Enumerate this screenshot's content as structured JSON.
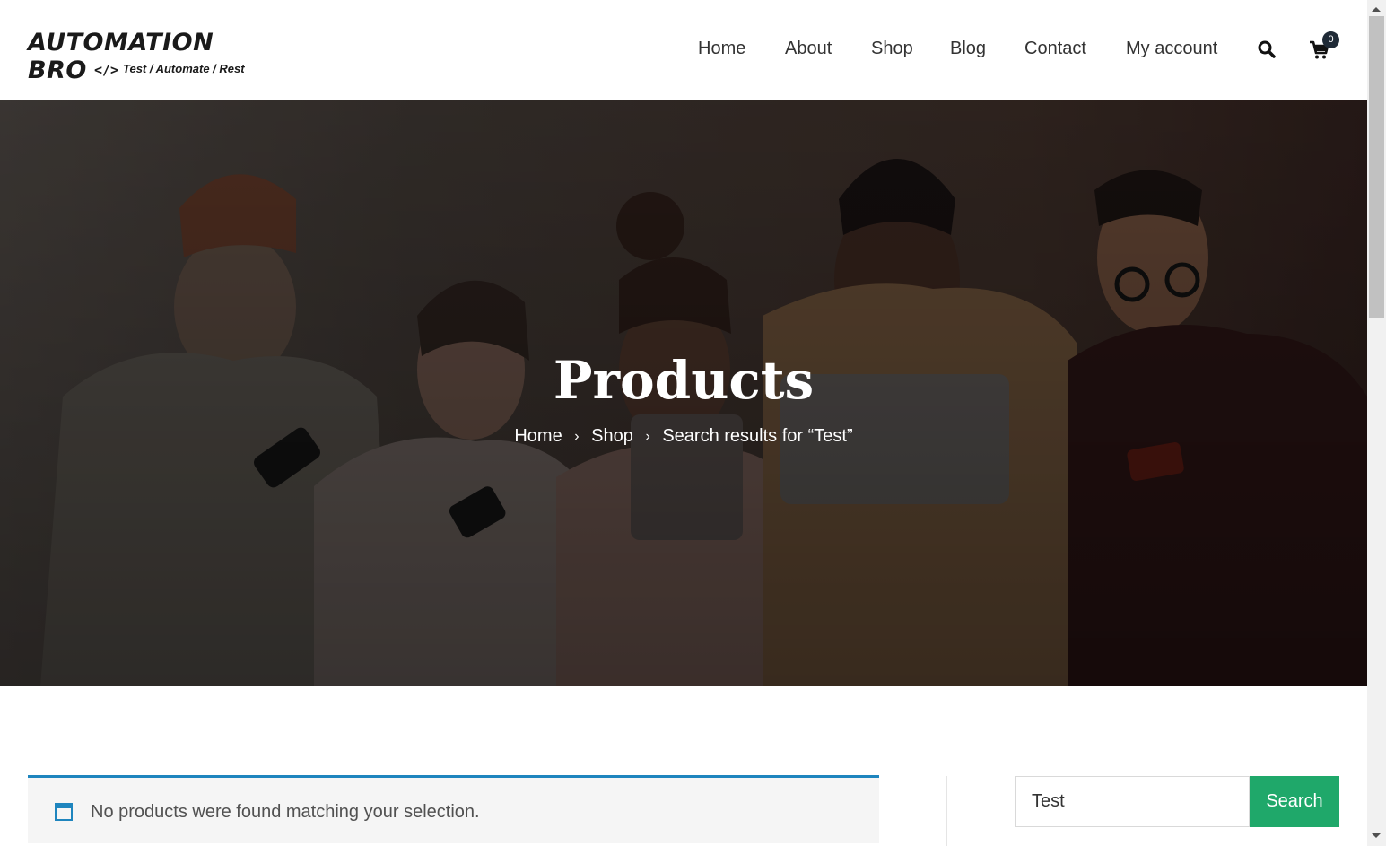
{
  "header": {
    "logo_main": "AUTOMATION BRO",
    "logo_code": "</>",
    "logo_tagline": "Test / Automate / Rest",
    "nav": [
      "Home",
      "About",
      "Shop",
      "Blog",
      "Contact",
      "My account"
    ],
    "cart_count": "0"
  },
  "hero": {
    "title": "Products",
    "breadcrumb": [
      "Home",
      "Shop",
      "Search results for “Test”"
    ],
    "separator": "›"
  },
  "notice": {
    "text": "No products were found matching your selection.",
    "accent_color": "#1e85be"
  },
  "search": {
    "value": "Test",
    "button_label": "Search",
    "button_color": "#1fa86a"
  }
}
